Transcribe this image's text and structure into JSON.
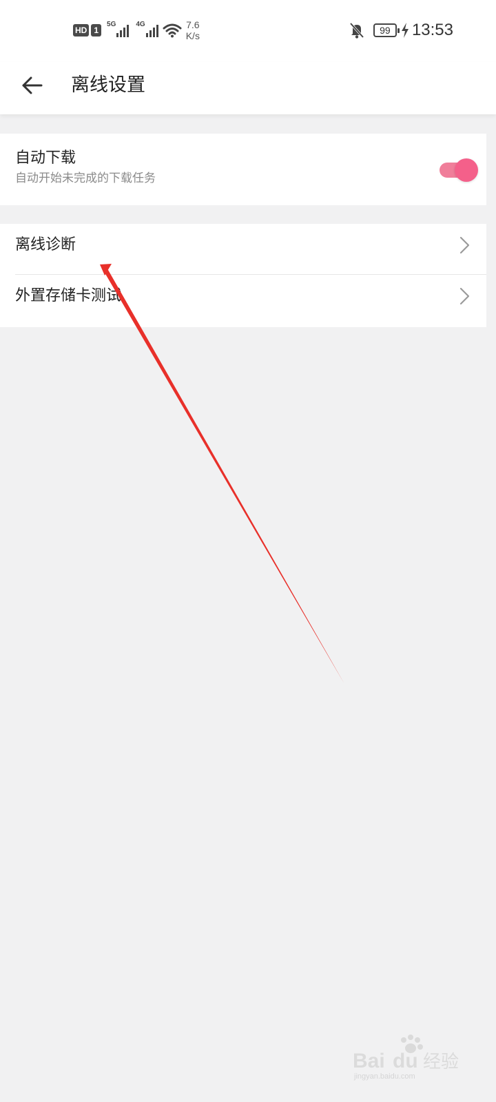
{
  "status_bar": {
    "hd_label": "HD",
    "sim_label": "1",
    "net1": "5G",
    "net2": "4G",
    "speed_value": "7.6",
    "speed_unit": "K/s",
    "battery": "99",
    "time": "13:53"
  },
  "header": {
    "title": "离线设置"
  },
  "settings": {
    "auto_download": {
      "title": "自动下载",
      "subtitle": "自动开始未完成的下载任务",
      "enabled": true
    },
    "items": [
      {
        "label": "离线诊断"
      },
      {
        "label": "外置存储卡测试"
      }
    ]
  },
  "colors": {
    "accent": "#f4608a",
    "annotation": "#e8302a"
  },
  "watermark": {
    "brand": "Bai",
    "brand_du": "du",
    "product": "经验",
    "site": "jingyan.baidu.com"
  }
}
